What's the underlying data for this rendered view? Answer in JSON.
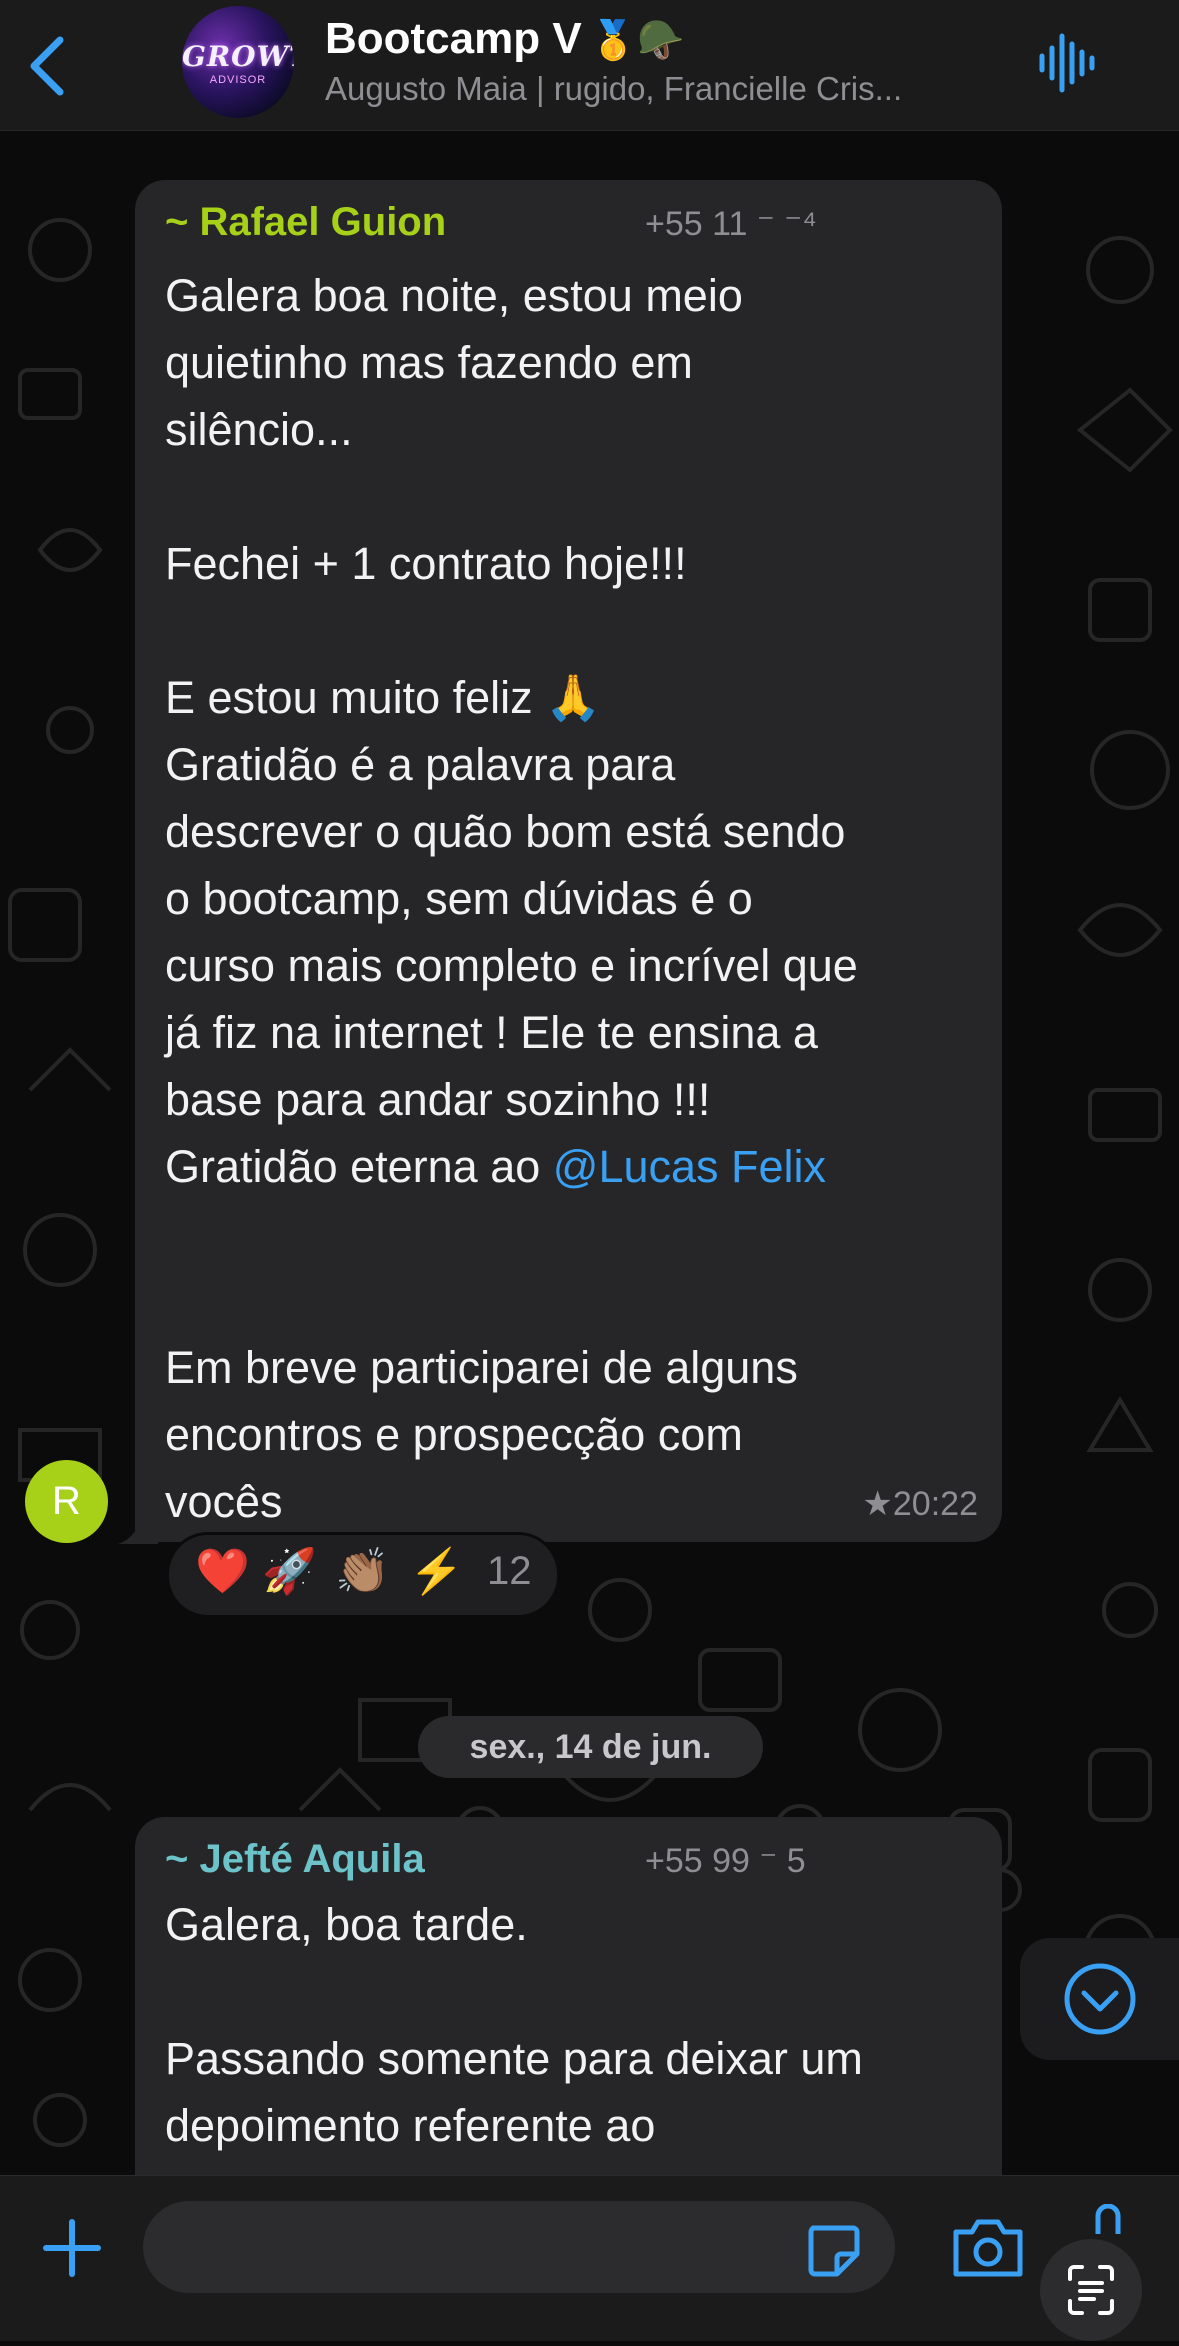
{
  "header": {
    "title": "Bootcamp V",
    "title_emojis": "🥇🪖",
    "subtitle": "Augusto Maia | rugido, Francielle Cris...",
    "avatar_text": "GROWTH",
    "avatar_subtext": "ADVISOR"
  },
  "messages": [
    {
      "sender": "~ Rafael Guion",
      "sender_color": "#a6d118",
      "phone": "+55 11 ⁻                  ⁻⁴",
      "text_before_mention": "Galera boa noite, estou meio\nquietinho mas fazendo em\nsilêncio...\n\nFechei + 1 contrato hoje!!!\n\nE estou muito feliz 🙏\nGratidão é a palavra para\ndescrever o quão bom está sendo\no bootcamp, sem dúvidas é o\ncurso mais completo e incrível que\njá fiz na internet ! Ele te ensina a\nbase para andar sozinho !!!\nGratidão eterna ao ",
      "mention": "@Lucas Felix",
      "text_after_mention": "\n\n\nEm breve participarei de alguns\nencontros e prospecção com\nvocês",
      "time": "★20:22",
      "avatar_initial": "R",
      "reactions": {
        "emojis": [
          "❤️",
          "🚀",
          "👏🏽",
          "⚡"
        ],
        "count": "12"
      }
    },
    {
      "sender": "~ Jefté Aquila",
      "sender_color": "#6cc3c9",
      "phone": "+55 99 ⁻                  5",
      "text": "Galera, boa tarde.\n\nPassando somente para deixar um\ndepoimento referente ao\nBoot..."
    }
  ],
  "date_separator": "sex., 14 de jun.",
  "input": {
    "placeholder": ""
  },
  "colors": {
    "accent": "#3aa0f3",
    "background": "#0b0b0b",
    "bubble": "#262628"
  }
}
